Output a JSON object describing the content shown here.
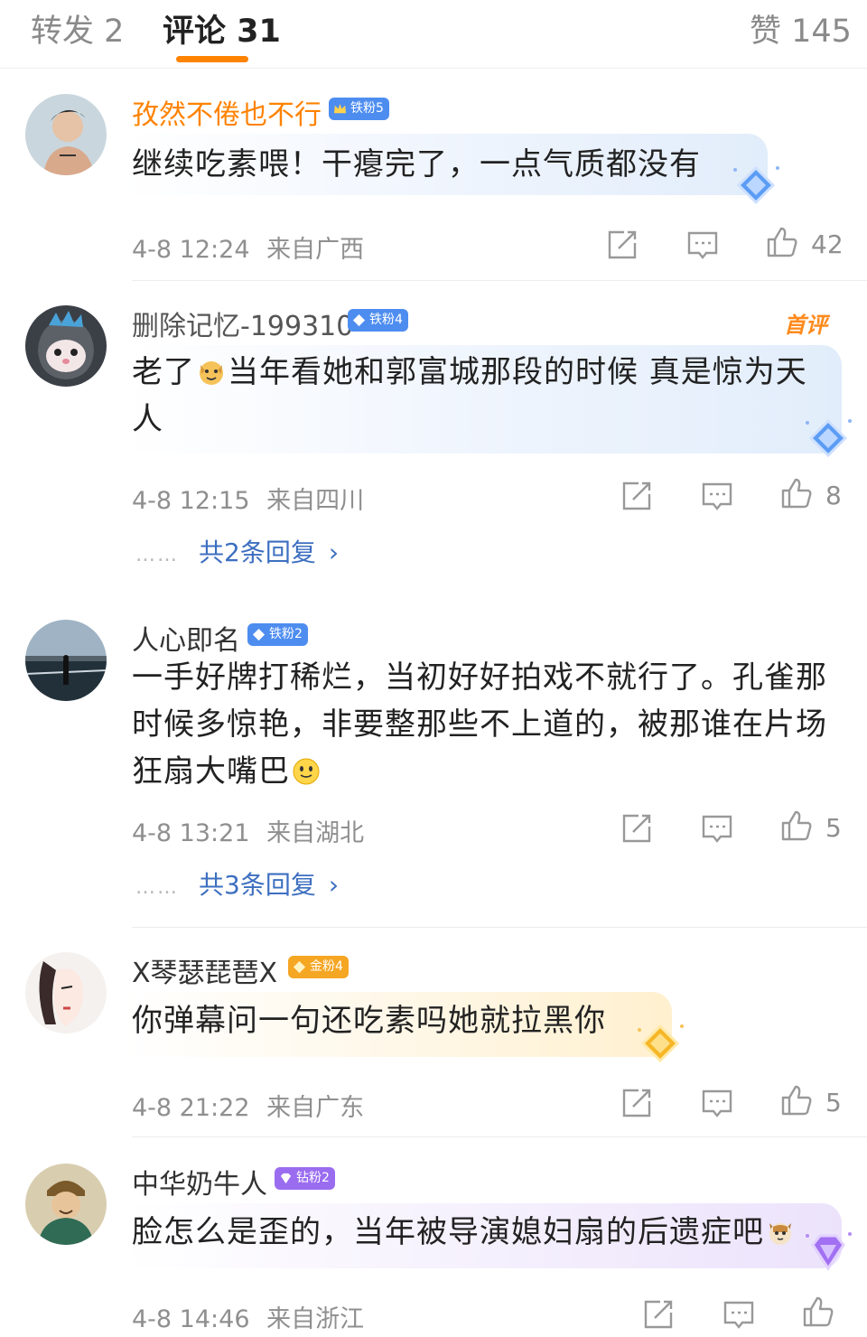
{
  "tabs": {
    "repost": "转发 2",
    "comments": "评论 31",
    "likes": "赞 145"
  },
  "colors": {
    "accent": "#ff8200",
    "reply_link": "#3d6fc0",
    "vip_name": "#ff8200",
    "iron_badge": "#4e8df0",
    "gold_badge": "#f5a623",
    "drill_badge": "#9a6cf0"
  },
  "comments": [
    {
      "username": "孜然不倦也不行",
      "badge": "铁粉5",
      "text": "继续吃素喂！干瘪完了，一点气质都没有",
      "time": "4-8 12:24",
      "location": "来自广西",
      "likes": "42",
      "icons": [
        "share-icon",
        "comment-icon",
        "like-icon"
      ]
    },
    {
      "username": "删除记忆-199310",
      "badge": "铁粉4",
      "tag": "首评",
      "text_a": "老了",
      "text_b": "当年看她和郭富城那段的时候 真是惊为天",
      "text_c": "人",
      "time": "4-8 12:15",
      "location": "来自四川",
      "likes": "8",
      "replies": "共2条回复"
    },
    {
      "username": "人心即名",
      "badge": "铁粉2",
      "text_line1": "一手好牌打稀烂，当初好好拍戏不就行了。孔雀那",
      "text_line2": "时候多惊艳，非要整那些不上道的，被那谁在片场",
      "text_line3": "狂扇大嘴巴",
      "time": "4-8 13:21",
      "location": "来自湖北",
      "likes": "5",
      "replies": "共3条回复"
    },
    {
      "username": "X琴瑟琵琶X",
      "badge": "金粉4",
      "text": "你弹幕问一句还吃素吗她就拉黑你",
      "time": "4-8 21:22",
      "location": "来自广东",
      "likes": "5"
    },
    {
      "username": "中华奶牛人",
      "badge": "钻粉2",
      "text": "脸怎么是歪的，当年被导演媳妇扇的后遗症吧",
      "time": "4-8 14:46",
      "location": "来自浙江"
    }
  ],
  "reply_dots": "……",
  "reply_chevron": "›"
}
